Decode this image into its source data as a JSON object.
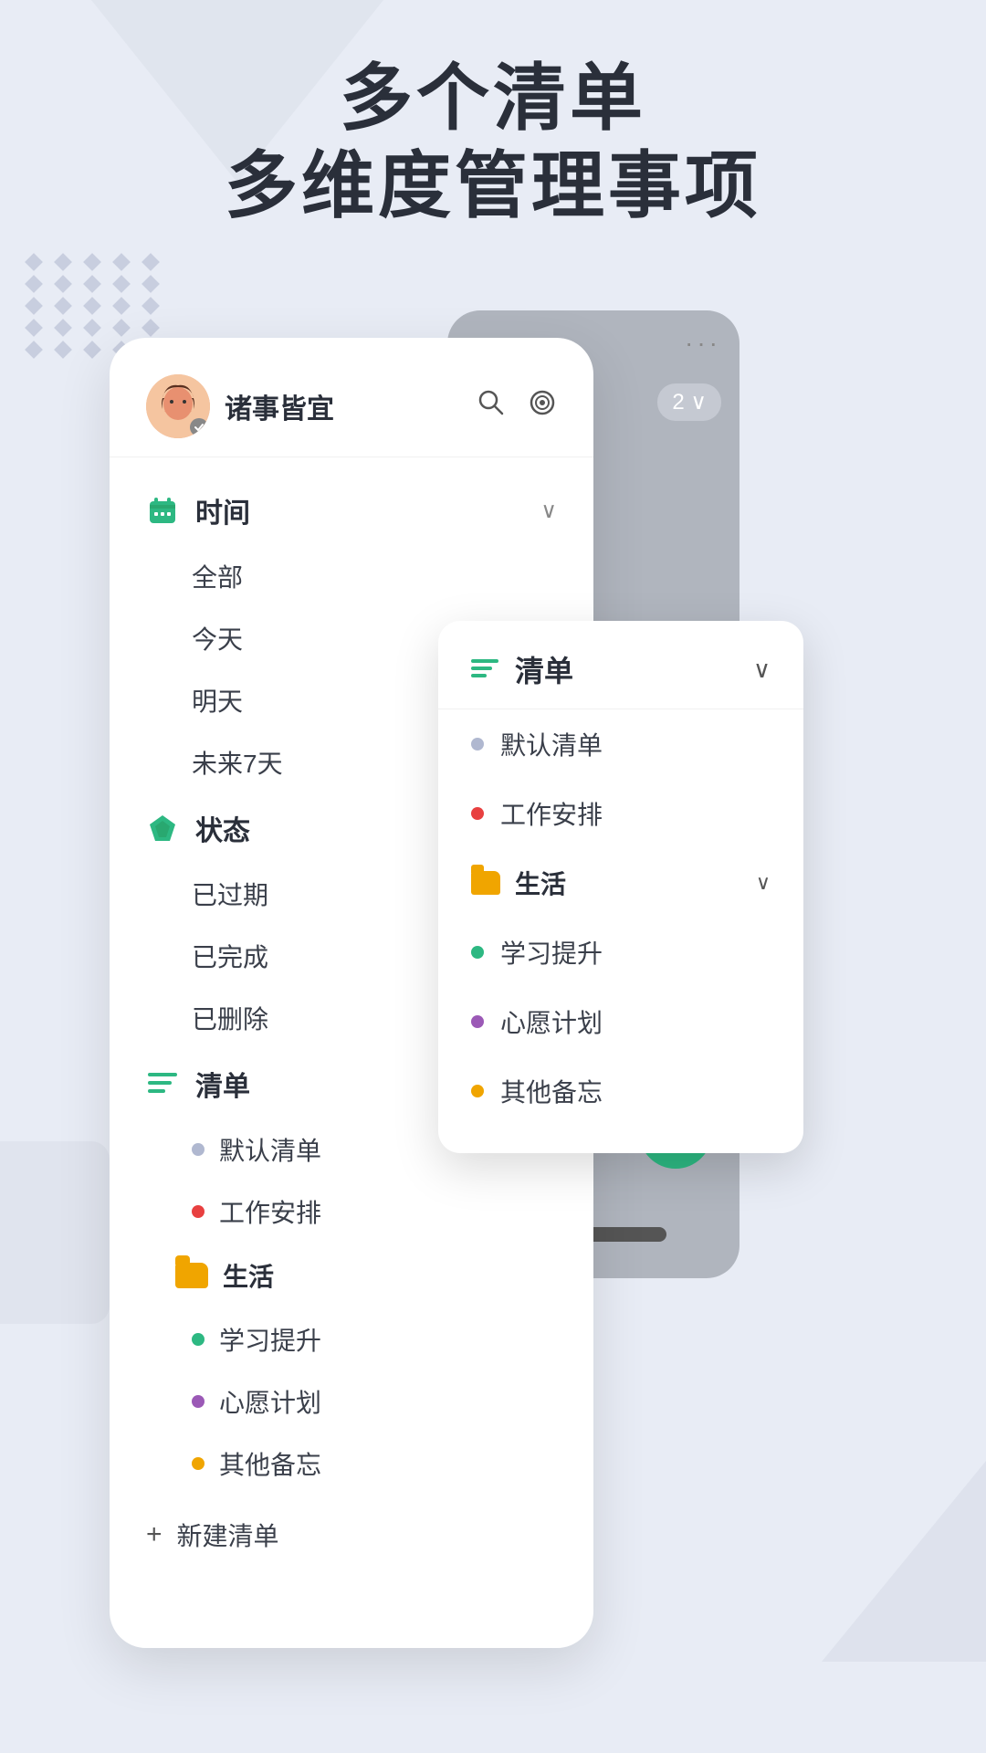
{
  "title": {
    "line1": "多个清单",
    "line2": "多维度管理事项"
  },
  "profile": {
    "name": "诸事皆宜",
    "search_icon": "search",
    "target_icon": "target"
  },
  "time_section": {
    "label": "时间",
    "items": [
      "全部",
      "今天",
      "明天",
      "未来7天"
    ]
  },
  "status_section": {
    "label": "状态",
    "items": [
      "已过期",
      "已完成",
      "已删除"
    ]
  },
  "list_section": {
    "label": "清单",
    "items": [
      {
        "name": "默认清单",
        "color": "#b0b8d0"
      },
      {
        "name": "工作安排",
        "color": "#e84040"
      }
    ],
    "folders": [
      {
        "name": "生活",
        "color": "#f0a500",
        "items": [
          {
            "name": "学习提升",
            "color": "#2db882"
          },
          {
            "name": "心愿计划",
            "color": "#9b59b6"
          },
          {
            "name": "其他备忘",
            "color": "#f0a500"
          }
        ]
      }
    ]
  },
  "new_list": "新建清单",
  "dropdown": {
    "title": "清单",
    "items": [
      {
        "name": "默认清单",
        "color": "#b0b8d0"
      },
      {
        "name": "工作安排",
        "color": "#e84040"
      }
    ],
    "folders": [
      {
        "name": "生活",
        "color": "#f0a500",
        "items": [
          {
            "name": "学习提升",
            "color": "#2db882"
          },
          {
            "name": "心愿计划",
            "color": "#9b59b6"
          },
          {
            "name": "其他备忘",
            "color": "#f0a500"
          }
        ]
      }
    ]
  },
  "phone_bg": {
    "dots": "···",
    "badge": "2",
    "fab_icon": "+",
    "badge_label": "2 ∨"
  }
}
